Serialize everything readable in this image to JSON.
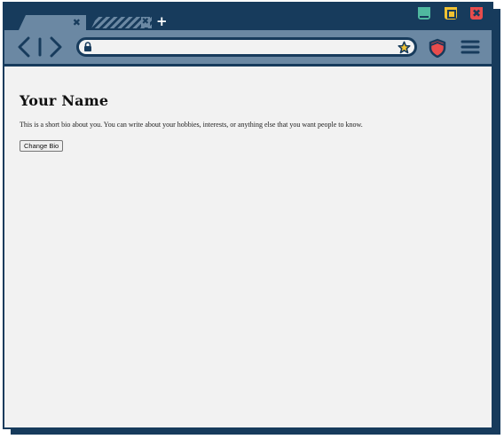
{
  "browser": {
    "tabs": [
      {
        "close_glyph": "✖",
        "active": true
      },
      {
        "close_glyph": "✖",
        "active": false
      }
    ],
    "new_tab_glyph": "+",
    "window_buttons": {
      "minimize_icon": "minimize-icon",
      "maximize_icon": "maximize-icon",
      "close_glyph": "✖"
    },
    "nav_icons": [
      "back-chevron-icon",
      "divider",
      "forward-chevron-icon"
    ],
    "url": "",
    "colors": {
      "frame": "#173b5c",
      "toolbar": "#6b88a3",
      "page_bg": "#f2f2f2",
      "minimize": "#4fb89f",
      "maximize": "#f1c232",
      "close": "#e84c4c",
      "shield": "#e84c4c",
      "star": "#f1c232"
    }
  },
  "page": {
    "title": "Your Name",
    "bio": "This is a short bio about you. You can write about your hobbies, interests, or anything else that you want people to know.",
    "button_label": "Change Bio"
  }
}
